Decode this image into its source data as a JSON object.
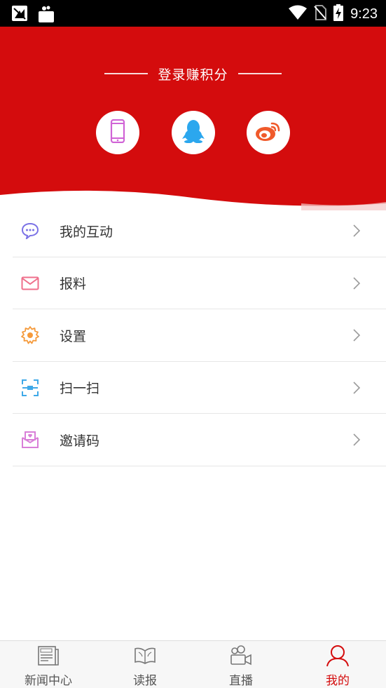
{
  "status_bar": {
    "time": "9:23",
    "icons": [
      "notification-icon",
      "shopping-bag-icon",
      "wifi-icon",
      "no-sim-icon",
      "battery-charging-icon"
    ]
  },
  "header": {
    "login_title": "登录赚积分",
    "social_logins": [
      {
        "name": "phone-login",
        "icon": "phone-icon",
        "color": "#d063d6"
      },
      {
        "name": "qq-login",
        "icon": "qq-penguin-icon",
        "color": "#2ba7ee"
      },
      {
        "name": "weibo-login",
        "icon": "weibo-icon",
        "color": "#f05a2b"
      }
    ],
    "background_color": "#d40c0d"
  },
  "menu": {
    "items": [
      {
        "label": "我的互动",
        "icon": "chat-bubble-icon",
        "color": "#7b72e6"
      },
      {
        "label": "报料",
        "icon": "envelope-icon",
        "color": "#ef6f8b"
      },
      {
        "label": "设置",
        "icon": "gear-icon",
        "color": "#f59a3b"
      },
      {
        "label": "扫一扫",
        "icon": "scan-icon",
        "color": "#3fa9e8"
      },
      {
        "label": "邀请码",
        "icon": "invite-envelope-icon",
        "color": "#d97fd8"
      }
    ]
  },
  "bottom_nav": {
    "items": [
      {
        "label": "新闻中心",
        "icon": "newspaper-icon",
        "active": false
      },
      {
        "label": "读报",
        "icon": "open-book-icon",
        "active": false
      },
      {
        "label": "直播",
        "icon": "video-camera-icon",
        "active": false
      },
      {
        "label": "我的",
        "icon": "user-icon",
        "active": true
      }
    ],
    "active_color": "#d40c0d"
  }
}
